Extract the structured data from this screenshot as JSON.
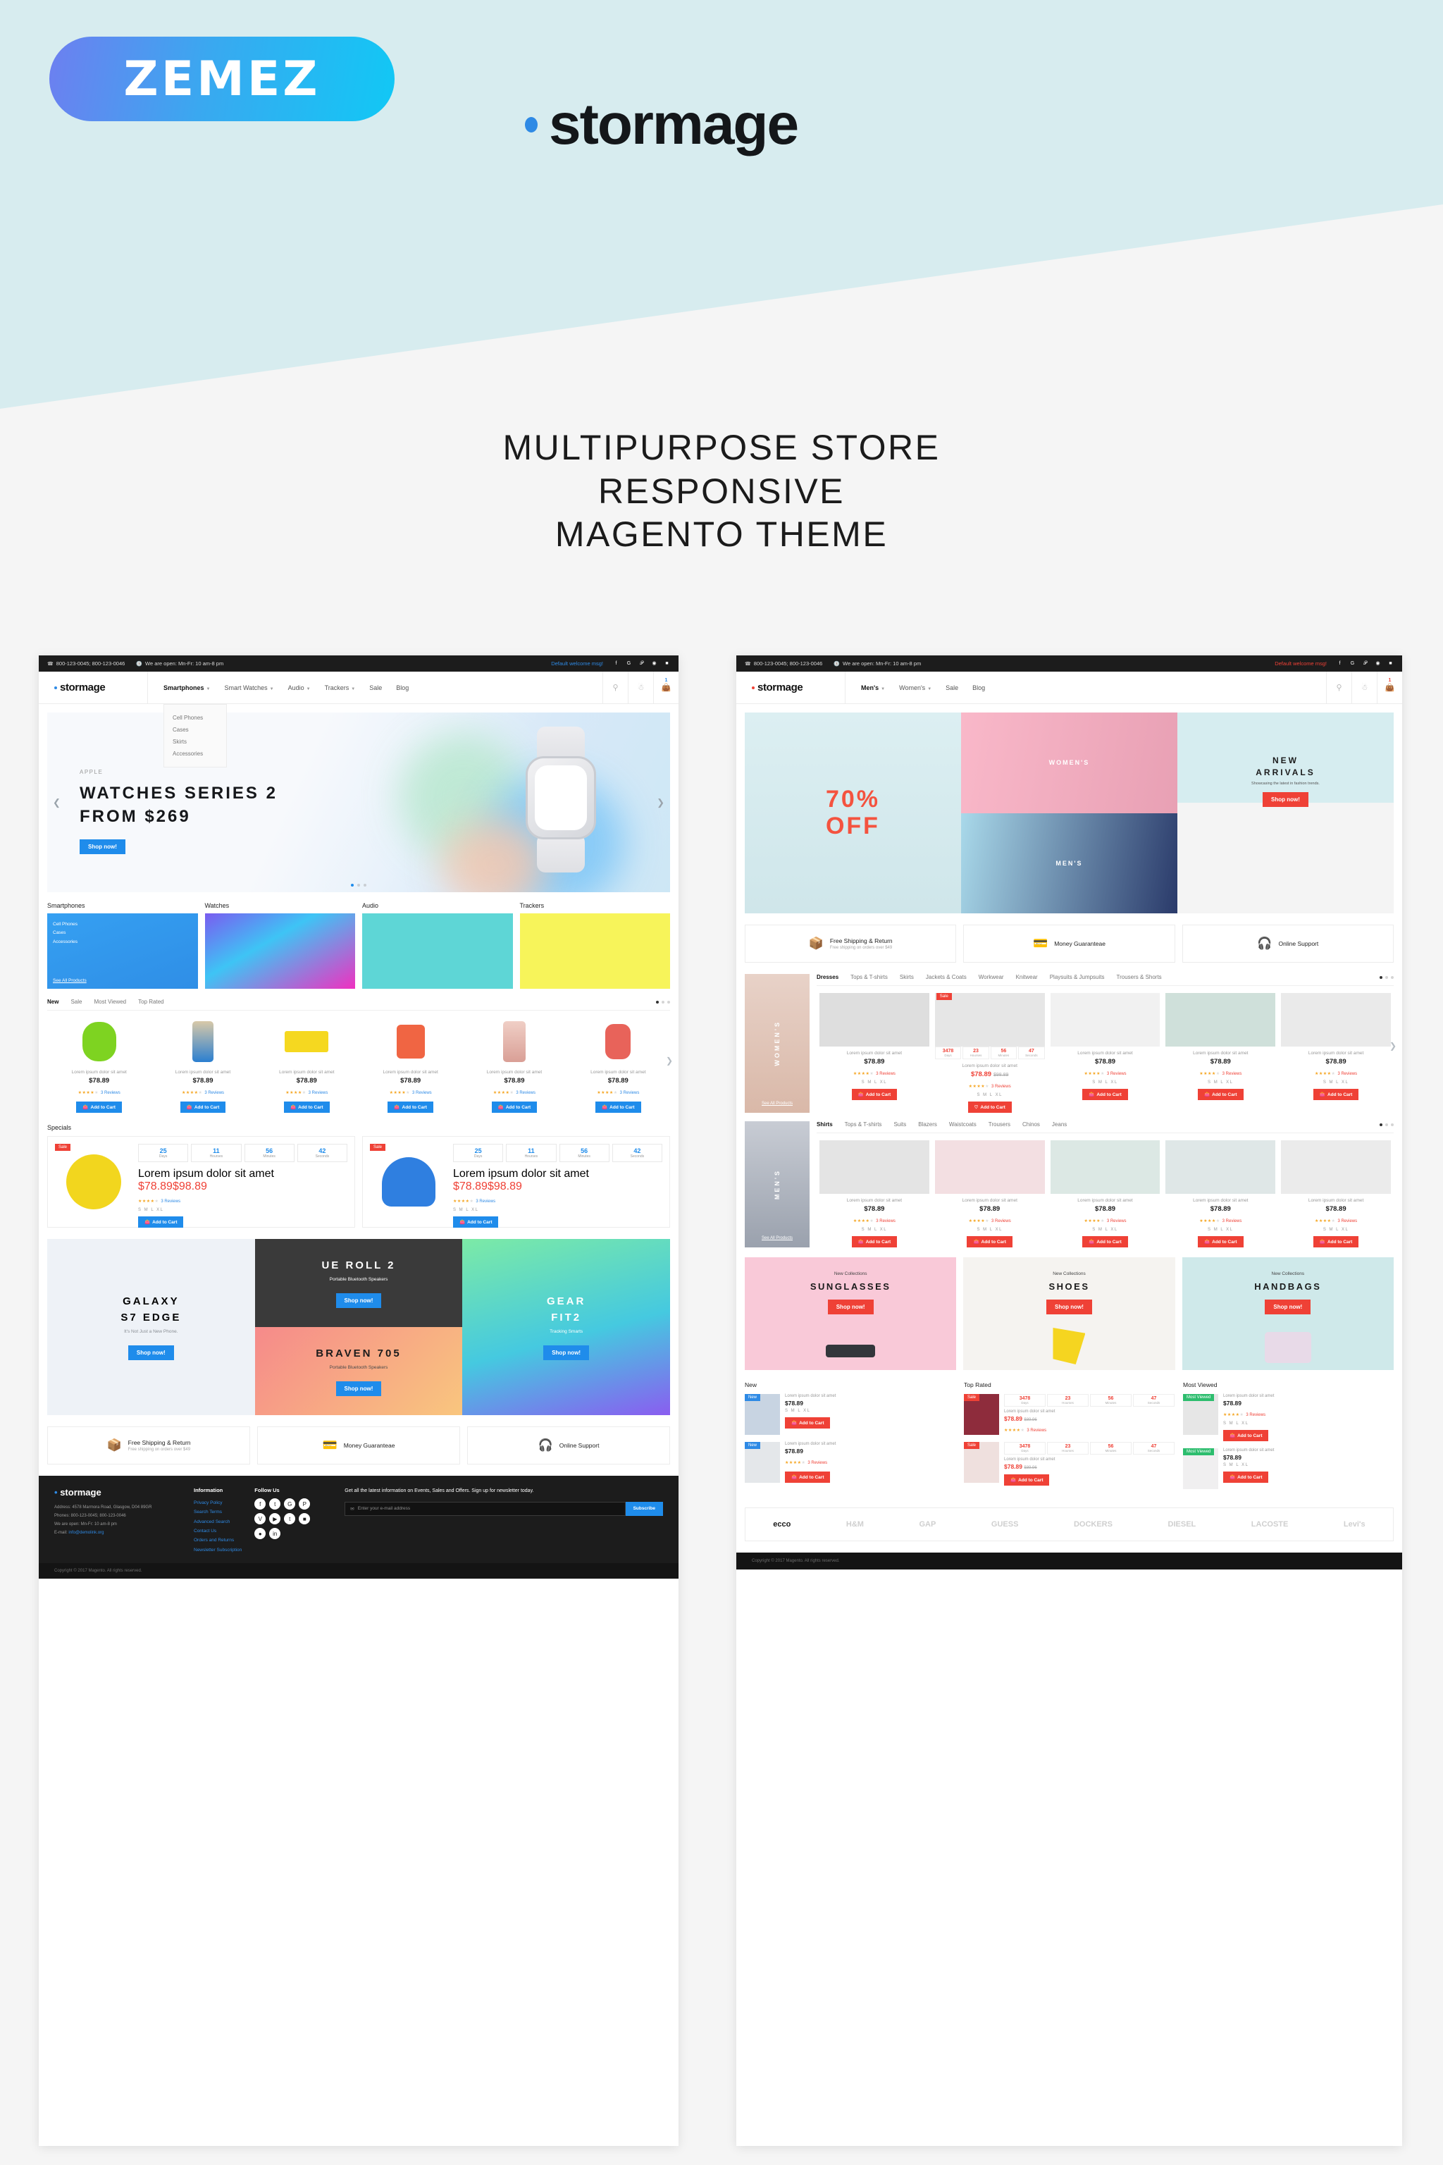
{
  "banner": {
    "zemez_logo": "ZEMEZ",
    "product_name": "stormage",
    "tagline_line1": "MULTIPURPOSE STORE",
    "tagline_line2": "RESPONSIVE",
    "tagline_line3": "MAGENTO THEME"
  },
  "colors": {
    "blue": "#1f8ceb",
    "red": "#ef4136",
    "dark": "#1c1c1c",
    "teal": "#d7ecef"
  },
  "common": {
    "phones": "800-123-0045; 800-123-0046",
    "hours": "We are open: Mn-Fr: 10 am-8 pm",
    "welcome": "Default welcome msg!",
    "brand": "stormage",
    "cart_count": "1",
    "product_name": "Lorem ipsum dolor sit amet",
    "price": "$78.89",
    "old_price": "$98.89",
    "reviews": "3 Reviews",
    "sizes": "S  M  L  XL",
    "add_to_cart": "Add to Cart",
    "shop_now": "Shop now!",
    "see_all_products": "See All Products",
    "sale_tag": "Sale",
    "new_tag": "New",
    "most_viewed_tag": "Most Viewed",
    "search_icon": "search-icon",
    "account_icon": "user-icon",
    "cart_icon": "cart-icon"
  },
  "services": [
    {
      "title": "Free Shipping & Return",
      "sub": "Free shipping on orders over $49",
      "icon": "shipping-bag-icon"
    },
    {
      "title": "Money Guaranteae",
      "sub": "",
      "icon": "wallet-icon"
    },
    {
      "title": "Online Support",
      "sub": "",
      "icon": "headset-icon"
    }
  ],
  "footer": {
    "brand": "stormage",
    "address": "Address: 4578 Marmora Road, Glasgow, D04 89GR",
    "phones": "Phones: 800-123-0045; 800-123-0046",
    "hours": "We are open: Mn-Fr: 10 am-8 pm",
    "email_label": "E-mail:",
    "email": "info@demolink.org",
    "information_title": "Information",
    "information_links": [
      "Privacy Policy",
      "Search Terms",
      "Advanced Search",
      "Contact Us",
      "Orders and Returns",
      "Newsletter Subscription"
    ],
    "follow_title": "Follow Us",
    "newsletter_text": "Get all the latest information on Events, Sales and Offers. Sign up for newsletter today.",
    "newsletter_placeholder": "Enter your e-mail address",
    "subscribe": "Subscribe",
    "copyright": "Copyright © 2017 Magento. All rights reserved."
  },
  "left_site": {
    "nav": [
      {
        "label": "Smartphones",
        "caret": true,
        "active": true
      },
      {
        "label": "Smart Watches",
        "caret": true,
        "active": false
      },
      {
        "label": "Audio",
        "caret": true,
        "active": false
      },
      {
        "label": "Trackers",
        "caret": true,
        "active": false
      },
      {
        "label": "Sale",
        "caret": false,
        "active": false
      },
      {
        "label": "Blog",
        "caret": false,
        "active": false
      }
    ],
    "dropdown": [
      "Cell Phones",
      "Cases",
      "Skirts",
      "Accessories"
    ],
    "hero": {
      "eyebrow": "APPLE",
      "title_line1": "WATCHES SERIES 2",
      "title_line2": "FROM $269",
      "cta": "Shop now!"
    },
    "categories": [
      {
        "title": "Smartphones",
        "overlay": [
          "Cell Phones",
          "Cases",
          "Accessories"
        ]
      },
      {
        "title": "Watches",
        "overlay": []
      },
      {
        "title": "Audio",
        "overlay": []
      },
      {
        "title": "Trackers",
        "overlay": []
      }
    ],
    "tabs": [
      "New",
      "Sale",
      "Most Viewed",
      "Top Rated"
    ],
    "specials_title": "Specials",
    "countdown": [
      {
        "n": "25",
        "l": "Days"
      },
      {
        "n": "11",
        "l": "Hourses"
      },
      {
        "n": "56",
        "l": "Minutes"
      },
      {
        "n": "42",
        "l": "Seconds"
      }
    ],
    "promos": [
      {
        "title_line1": "GALAXY",
        "title_line2": "S7 EDGE",
        "sub": "It's Not Just a New Phone.",
        "cta": "Shop now!"
      },
      {
        "title_line1": "UE ROLL 2",
        "title_line2": "",
        "sub": "Portable Bluetooth Speakers",
        "cta": "Shop now!"
      },
      {
        "title_line1": "BRAVEN 705",
        "title_line2": "",
        "sub": "Portable Bluetooth Speakers",
        "cta": "Shop now!"
      },
      {
        "title_line1": "GEAR",
        "title_line2": "FIT2",
        "sub": "Tracking Smarts",
        "cta": "Shop now!"
      }
    ]
  },
  "right_site": {
    "nav": [
      {
        "label": "Men's",
        "caret": true,
        "active": true
      },
      {
        "label": "Women's",
        "caret": true,
        "active": false
      },
      {
        "label": "Sale",
        "caret": false,
        "active": false
      },
      {
        "label": "Blog",
        "caret": false,
        "active": false
      }
    ],
    "hero": {
      "discount": "70%\nOFF",
      "discount_l1": "70%",
      "discount_l2": "OFF",
      "womens": "WOMEN'S",
      "mens": "MEN'S",
      "arrivals_l1": "NEW",
      "arrivals_l2": "ARRIVALS",
      "arrivals_sub": "Showcasing the latest in fashion trends.",
      "cta": "Shop now!"
    },
    "women_label": "WOMEN'S",
    "men_label": "MEN'S",
    "women_tabs": [
      "Dresses",
      "Tops & T-shirts",
      "Skirts",
      "Jackets & Coats",
      "Workwear",
      "Knitwear",
      "Playsuits & Jumpsuits",
      "Trousers & Shorts"
    ],
    "men_tabs": [
      "Shirts",
      "Tops & T-shirts",
      "Suits",
      "Blazers",
      "Waistcoats",
      "Trousers",
      "Chinos",
      "Jeans"
    ],
    "women_countdown": [
      {
        "n": "3478",
        "l": "Days"
      },
      {
        "n": "23",
        "l": "Hourses"
      },
      {
        "n": "56",
        "l": "Minutes"
      },
      {
        "n": "47",
        "l": "Seconds"
      }
    ],
    "collections": [
      {
        "eyebrow": "New Collections",
        "title": "SUNGLASSES",
        "cta": "Shop now!"
      },
      {
        "eyebrow": "New Collections",
        "title": "SHOES",
        "cta": "Shop now!"
      },
      {
        "eyebrow": "New Collections",
        "title": "HANDBAGS",
        "cta": "Shop now!"
      }
    ],
    "lists": [
      {
        "heading": "New"
      },
      {
        "heading": "Top Rated"
      },
      {
        "heading": "Most Viewed"
      }
    ],
    "list_countdown": [
      {
        "n": "3478",
        "l": "Days"
      },
      {
        "n": "23",
        "l": "Hourses"
      },
      {
        "n": "56",
        "l": "Minutes"
      },
      {
        "n": "47",
        "l": "Seconds"
      }
    ],
    "list_old_price": "$89.96",
    "brands": [
      "ecco",
      "H&M",
      "GAP",
      "GUESS",
      "DOCKERS",
      "DIESEL",
      "LACOSTE",
      "Levi's"
    ]
  }
}
